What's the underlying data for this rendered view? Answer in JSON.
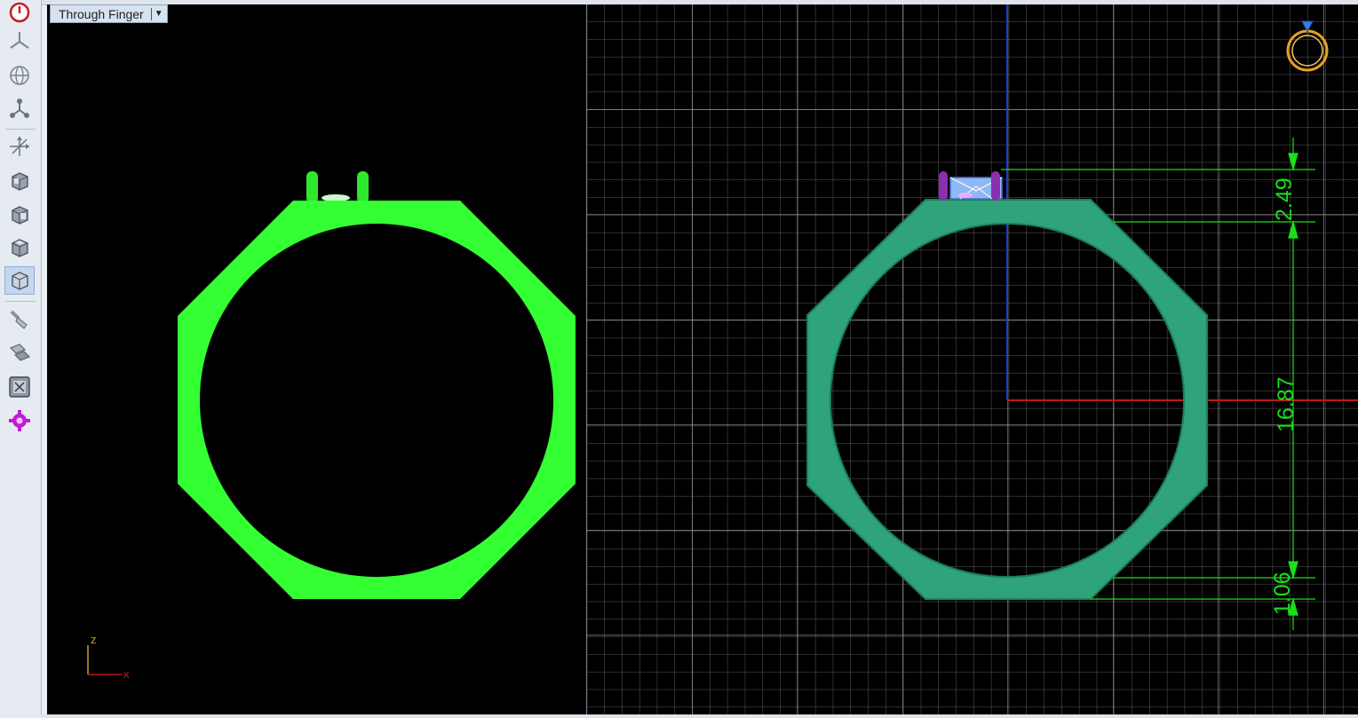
{
  "viewport_left": {
    "view_mode": "Through Finger",
    "axis": {
      "z_label": "z",
      "x_label": "x"
    },
    "colors": {
      "ring": "#33ff33",
      "background": "#000000"
    }
  },
  "viewport_right": {
    "dimensions": [
      {
        "name": "prong-height",
        "value": "2.49"
      },
      {
        "name": "inner-diameter",
        "value": "16.87"
      },
      {
        "name": "shank-thickness",
        "value": "1.06"
      }
    ],
    "colors": {
      "ring": "#2fa37a",
      "prongs": "#8a2fb0",
      "stone": "#8fb9f2",
      "dimension": "#19e019",
      "grid": "#8c8c8c",
      "axis_x": "#c01818",
      "axis_z": "#1a3fd6",
      "gizmo": "#e8a020"
    }
  },
  "toolbar": {
    "tools": [
      {
        "name": "power-icon"
      },
      {
        "name": "perspective-icon"
      },
      {
        "name": "globe-icon"
      },
      {
        "name": "nodes-icon"
      },
      {
        "name": "axes-icon"
      },
      {
        "name": "cube-front-icon"
      },
      {
        "name": "cube-side-icon"
      },
      {
        "name": "cube-top-icon"
      },
      {
        "name": "cube-iso-icon",
        "active": true
      },
      {
        "name": "brush-icon"
      },
      {
        "name": "plates-icon"
      },
      {
        "name": "fit-view-icon"
      },
      {
        "name": "gear-icon"
      }
    ]
  }
}
